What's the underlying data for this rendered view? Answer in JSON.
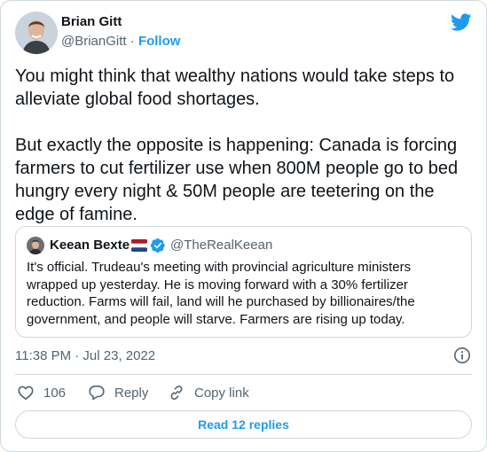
{
  "author": {
    "name": "Brian Gitt",
    "handle": "@BrianGitt",
    "separator": "·",
    "follow_label": "Follow"
  },
  "tweet": {
    "text": "You might think that wealthy nations would take steps to alleviate global food shortages.\n\nBut exactly the opposite is happening: Canada is forcing farmers to cut fertilizer use when 800M people go to bed hungry every night & 50M people are teetering on the edge of famine."
  },
  "quoted_tweet": {
    "name": "Keean Bexte",
    "handle": "@TheRealKeean",
    "text": "It's official. Trudeau's meeting with provincial agriculture ministers wrapped up yesterday. He is moving forward with a 30% fertilizer reduction. Farms will fail, land will he purchased by billionaires/the government, and people will starve. Farmers are rising up today."
  },
  "timestamp": "11:38 PM · Jul 23, 2022",
  "actions": {
    "like_count": "106",
    "reply_label": "Reply",
    "copy_label": "Copy link"
  },
  "read_replies_label": "Read 12 replies",
  "icons": {
    "brand": "twitter-bird-icon",
    "like": "heart-icon",
    "reply": "speech-bubble-icon",
    "copy": "link-icon",
    "info": "info-icon",
    "verified": "verified-badge-icon",
    "flag": "netherlands-flag-icon"
  },
  "colors": {
    "accent": "#1d9bf0",
    "text": "#0f1419",
    "secondary": "#536471",
    "border": "#cfd9de"
  }
}
